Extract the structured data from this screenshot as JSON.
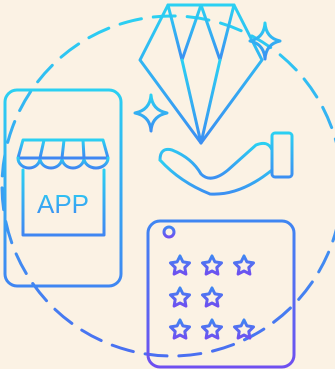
{
  "illustration": {
    "concept": "app-store-premium-rating",
    "store_label": "APP",
    "rating_rows": [
      3,
      2,
      3
    ],
    "colors": {
      "background": "#fbf2e4",
      "gradient_cyan": "#2bd0f2",
      "gradient_blue": "#3f86f2",
      "gradient_violet": "#6f4ff0"
    }
  }
}
